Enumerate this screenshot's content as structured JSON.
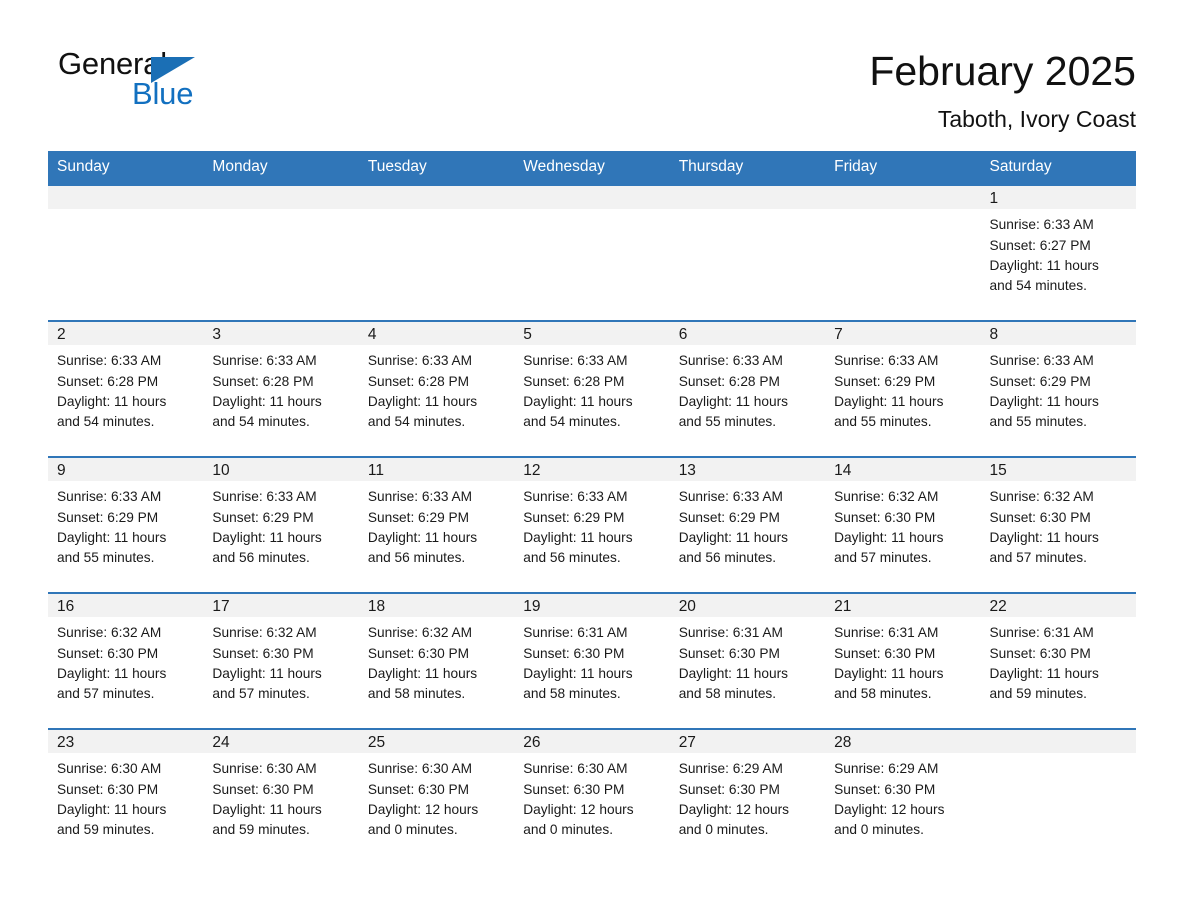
{
  "brand": {
    "word_one": "General",
    "word_two": "Blue",
    "flag_icon": "triangle-flag-icon",
    "blue": "#1270c0"
  },
  "header": {
    "title": "February 2025",
    "subtitle": "Taboth, Ivory Coast"
  },
  "calendar": {
    "accent_color": "#3076b8",
    "weekday_headers": [
      "Sunday",
      "Monday",
      "Tuesday",
      "Wednesday",
      "Thursday",
      "Friday",
      "Saturday"
    ],
    "weeks": [
      [
        {
          "day": "",
          "lines": []
        },
        {
          "day": "",
          "lines": []
        },
        {
          "day": "",
          "lines": []
        },
        {
          "day": "",
          "lines": []
        },
        {
          "day": "",
          "lines": []
        },
        {
          "day": "",
          "lines": []
        },
        {
          "day": "1",
          "lines": [
            "Sunrise: 6:33 AM",
            "Sunset: 6:27 PM",
            "Daylight: 11 hours",
            "and 54 minutes."
          ]
        }
      ],
      [
        {
          "day": "2",
          "lines": [
            "Sunrise: 6:33 AM",
            "Sunset: 6:28 PM",
            "Daylight: 11 hours",
            "and 54 minutes."
          ]
        },
        {
          "day": "3",
          "lines": [
            "Sunrise: 6:33 AM",
            "Sunset: 6:28 PM",
            "Daylight: 11 hours",
            "and 54 minutes."
          ]
        },
        {
          "day": "4",
          "lines": [
            "Sunrise: 6:33 AM",
            "Sunset: 6:28 PM",
            "Daylight: 11 hours",
            "and 54 minutes."
          ]
        },
        {
          "day": "5",
          "lines": [
            "Sunrise: 6:33 AM",
            "Sunset: 6:28 PM",
            "Daylight: 11 hours",
            "and 54 minutes."
          ]
        },
        {
          "day": "6",
          "lines": [
            "Sunrise: 6:33 AM",
            "Sunset: 6:28 PM",
            "Daylight: 11 hours",
            "and 55 minutes."
          ]
        },
        {
          "day": "7",
          "lines": [
            "Sunrise: 6:33 AM",
            "Sunset: 6:29 PM",
            "Daylight: 11 hours",
            "and 55 minutes."
          ]
        },
        {
          "day": "8",
          "lines": [
            "Sunrise: 6:33 AM",
            "Sunset: 6:29 PM",
            "Daylight: 11 hours",
            "and 55 minutes."
          ]
        }
      ],
      [
        {
          "day": "9",
          "lines": [
            "Sunrise: 6:33 AM",
            "Sunset: 6:29 PM",
            "Daylight: 11 hours",
            "and 55 minutes."
          ]
        },
        {
          "day": "10",
          "lines": [
            "Sunrise: 6:33 AM",
            "Sunset: 6:29 PM",
            "Daylight: 11 hours",
            "and 56 minutes."
          ]
        },
        {
          "day": "11",
          "lines": [
            "Sunrise: 6:33 AM",
            "Sunset: 6:29 PM",
            "Daylight: 11 hours",
            "and 56 minutes."
          ]
        },
        {
          "day": "12",
          "lines": [
            "Sunrise: 6:33 AM",
            "Sunset: 6:29 PM",
            "Daylight: 11 hours",
            "and 56 minutes."
          ]
        },
        {
          "day": "13",
          "lines": [
            "Sunrise: 6:33 AM",
            "Sunset: 6:29 PM",
            "Daylight: 11 hours",
            "and 56 minutes."
          ]
        },
        {
          "day": "14",
          "lines": [
            "Sunrise: 6:32 AM",
            "Sunset: 6:30 PM",
            "Daylight: 11 hours",
            "and 57 minutes."
          ]
        },
        {
          "day": "15",
          "lines": [
            "Sunrise: 6:32 AM",
            "Sunset: 6:30 PM",
            "Daylight: 11 hours",
            "and 57 minutes."
          ]
        }
      ],
      [
        {
          "day": "16",
          "lines": [
            "Sunrise: 6:32 AM",
            "Sunset: 6:30 PM",
            "Daylight: 11 hours",
            "and 57 minutes."
          ]
        },
        {
          "day": "17",
          "lines": [
            "Sunrise: 6:32 AM",
            "Sunset: 6:30 PM",
            "Daylight: 11 hours",
            "and 57 minutes."
          ]
        },
        {
          "day": "18",
          "lines": [
            "Sunrise: 6:32 AM",
            "Sunset: 6:30 PM",
            "Daylight: 11 hours",
            "and 58 minutes."
          ]
        },
        {
          "day": "19",
          "lines": [
            "Sunrise: 6:31 AM",
            "Sunset: 6:30 PM",
            "Daylight: 11 hours",
            "and 58 minutes."
          ]
        },
        {
          "day": "20",
          "lines": [
            "Sunrise: 6:31 AM",
            "Sunset: 6:30 PM",
            "Daylight: 11 hours",
            "and 58 minutes."
          ]
        },
        {
          "day": "21",
          "lines": [
            "Sunrise: 6:31 AM",
            "Sunset: 6:30 PM",
            "Daylight: 11 hours",
            "and 58 minutes."
          ]
        },
        {
          "day": "22",
          "lines": [
            "Sunrise: 6:31 AM",
            "Sunset: 6:30 PM",
            "Daylight: 11 hours",
            "and 59 minutes."
          ]
        }
      ],
      [
        {
          "day": "23",
          "lines": [
            "Sunrise: 6:30 AM",
            "Sunset: 6:30 PM",
            "Daylight: 11 hours",
            "and 59 minutes."
          ]
        },
        {
          "day": "24",
          "lines": [
            "Sunrise: 6:30 AM",
            "Sunset: 6:30 PM",
            "Daylight: 11 hours",
            "and 59 minutes."
          ]
        },
        {
          "day": "25",
          "lines": [
            "Sunrise: 6:30 AM",
            "Sunset: 6:30 PM",
            "Daylight: 12 hours",
            "and 0 minutes."
          ]
        },
        {
          "day": "26",
          "lines": [
            "Sunrise: 6:30 AM",
            "Sunset: 6:30 PM",
            "Daylight: 12 hours",
            "and 0 minutes."
          ]
        },
        {
          "day": "27",
          "lines": [
            "Sunrise: 6:29 AM",
            "Sunset: 6:30 PM",
            "Daylight: 12 hours",
            "and 0 minutes."
          ]
        },
        {
          "day": "28",
          "lines": [
            "Sunrise: 6:29 AM",
            "Sunset: 6:30 PM",
            "Daylight: 12 hours",
            "and 0 minutes."
          ]
        },
        {
          "day": "",
          "lines": []
        }
      ]
    ]
  }
}
